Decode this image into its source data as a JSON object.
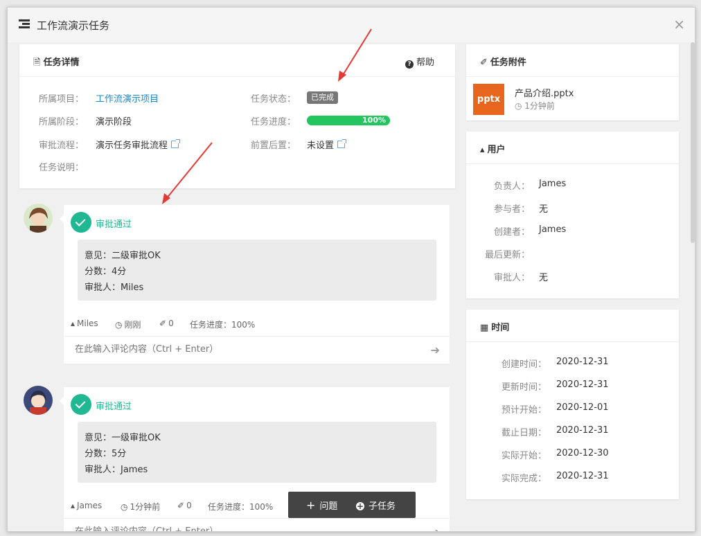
{
  "window": {
    "title": "工作流演示任务",
    "close": "×"
  },
  "task_detail": {
    "header": "任务详情",
    "help": "帮助",
    "project_label": "所属项目：",
    "project_value": "工作流演示项目",
    "stage_label": "所属阶段：",
    "stage_value": "演示阶段",
    "flow_label": "审批流程：",
    "flow_value": "演示任务审批流程",
    "desc_label": "任务说明：",
    "status_label": "任务状态：",
    "status_value": "已完成",
    "progress_label": "任务进度：",
    "progress_value": "100%",
    "progress_fraction": 1.0,
    "prereq_label": "前置后置：",
    "prereq_value": "未设置"
  },
  "approvals": [
    {
      "title": "审批通过",
      "opinion": "意见：二级审批OK",
      "score": "分数：4分",
      "approver": "审批人：Miles",
      "user": "Miles",
      "time": "刚刚",
      "attachments": "0",
      "progress": "任务进度：100%",
      "comment_placeholder": "在此输入评论内容（Ctrl + Enter）"
    },
    {
      "title": "审批通过",
      "opinion": "意见：一级审批OK",
      "score": "分数：5分",
      "approver": "审批人：James",
      "user": "James",
      "time": "1分钟前",
      "attachments": "0",
      "progress": "任务进度：100%",
      "comment_placeholder": "在此输入评论内容（Ctrl + Enter）"
    }
  ],
  "attachments": {
    "header": "任务附件",
    "items": [
      {
        "type": "pptx",
        "name": "产品介绍.pptx",
        "time": "1分钟前"
      }
    ]
  },
  "users": {
    "header": "用户",
    "owner_label": "负责人：",
    "owner": "James",
    "participant_label": "参与者：",
    "participant": "无",
    "creator_label": "创建者：",
    "creator": "James",
    "updated_label": "最后更新：",
    "approver_label": "审批人：",
    "approver": "无"
  },
  "times": {
    "header": "时间",
    "rows": [
      {
        "label": "创建时间：",
        "value": "2020-12-31"
      },
      {
        "label": "更新时间：",
        "value": "2020-12-31"
      },
      {
        "label": "预计开始：",
        "value": "2020-12-01"
      },
      {
        "label": "截止日期：",
        "value": "2020-12-31"
      },
      {
        "label": "实际开始：",
        "value": "2020-12-30"
      },
      {
        "label": "实际完成：",
        "value": "2020-12-31"
      }
    ]
  },
  "toolbar": {
    "issue": "问题",
    "subtask": "子任务"
  },
  "colors": {
    "accent": "#1fb893",
    "link": "#1e88c9",
    "pptx": "#e7651d",
    "progress": "#22c55e",
    "annotation": "#e53935"
  }
}
